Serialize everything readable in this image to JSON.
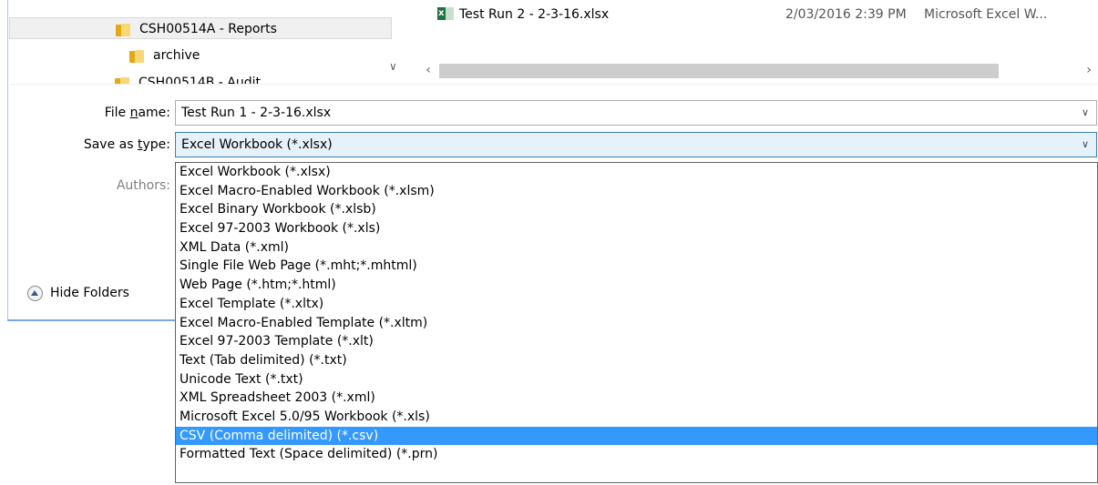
{
  "tree": {
    "items": [
      {
        "label": "CSH00514A - Reports",
        "selected": true
      },
      {
        "label": "archive",
        "selected": false
      },
      {
        "label": "CSH00514B - Audit",
        "selected": false
      }
    ]
  },
  "files": {
    "rows": [
      {
        "name": "Test Run 2 - 2-3-16.xlsx",
        "date": "2/03/2016 2:39 PM",
        "type": "Microsoft Excel W..."
      }
    ]
  },
  "form": {
    "file_name_label_pre": "File ",
    "file_name_label_key": "n",
    "file_name_label_post": "ame:",
    "file_name_value": "Test Run 1 - 2-3-16.xlsx",
    "save_type_label_pre": "Save as ",
    "save_type_label_key": "t",
    "save_type_label_post": "ype:",
    "save_type_value": "Excel Workbook (*.xlsx)",
    "authors_label": "Authors:"
  },
  "hide_folders_label": "Hide Folders",
  "dropdown": {
    "selected_index": 16,
    "options": [
      "Excel Workbook (*.xlsx)",
      "Excel Macro-Enabled Workbook (*.xlsm)",
      "Excel Binary Workbook (*.xlsb)",
      "Excel 97-2003 Workbook (*.xls)",
      "XML Data (*.xml)",
      "Single File Web Page (*.mht;*.mhtml)",
      "Web Page (*.htm;*.html)",
      "Excel Template (*.xltx)",
      "Excel Macro-Enabled Template (*.xltm)",
      "Excel 97-2003 Template (*.xlt)",
      "Text (Tab delimited) (*.txt)",
      "Unicode Text (*.txt)",
      "XML Spreadsheet 2003 (*.xml)",
      "Microsoft Excel 5.0/95 Workbook (*.xls)",
      "CSV (Comma delimited) (*.csv)",
      "Formatted Text (Space delimited) (*.prn)"
    ]
  },
  "colors": {
    "highlight": "#3399ff",
    "focus_border": "#3c7fb1",
    "folder": "#e4a817"
  }
}
